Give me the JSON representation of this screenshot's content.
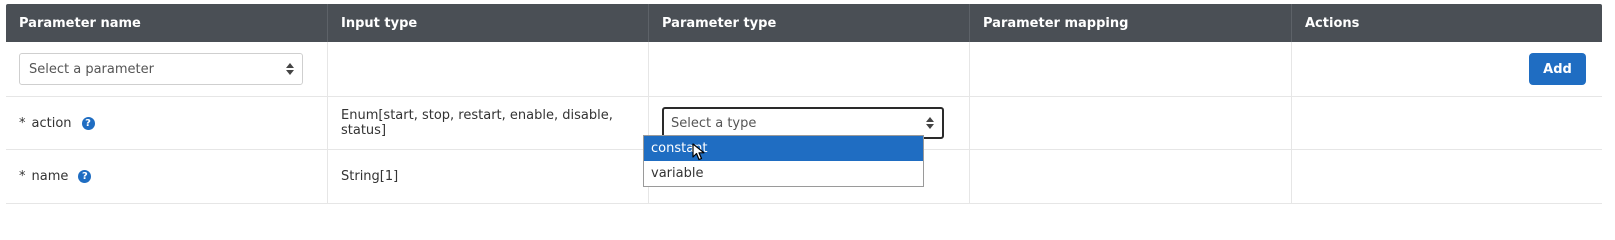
{
  "header": {
    "columns": [
      "Parameter name",
      "Input type",
      "Parameter type",
      "Parameter mapping",
      "Actions"
    ]
  },
  "add_row": {
    "select_placeholder": "Select a parameter",
    "add_label": "Add"
  },
  "rows": [
    {
      "required": "*",
      "name": "action",
      "input_type": "Enum[start, stop, restart, enable, disable, status]",
      "type_placeholder": "Select a type"
    },
    {
      "required": "*",
      "name": "name",
      "input_type": "String[1]"
    }
  ],
  "dropdown": {
    "options": [
      "constant",
      "variable"
    ],
    "highlighted_option": "constant"
  },
  "icons": {
    "help": "help-circle-icon",
    "caret": "select-caret-icon",
    "cursor": "mouse-pointer-icon"
  },
  "colors": {
    "header_bg": "#4a4f55",
    "accent": "#1f6dc2"
  }
}
